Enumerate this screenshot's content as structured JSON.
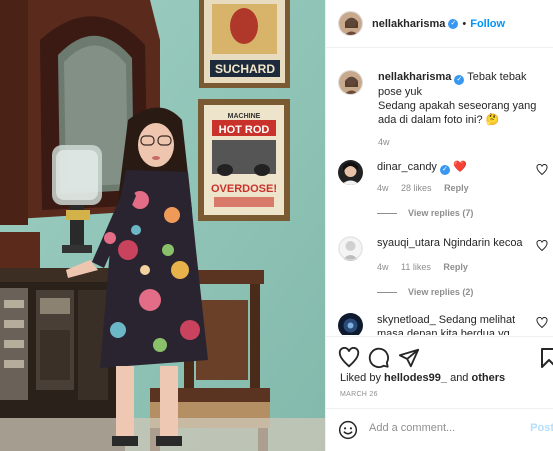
{
  "post": {
    "username": "nellakharisma",
    "follow_label": "Follow",
    "separator": "•",
    "caption_line1": "Tebak tebak pose yuk",
    "caption_line2": "Sedang apakah seseorang yang ada di dalam foto ini? 🤔",
    "caption_time": "4w",
    "liked_by_prefix": "Liked by ",
    "liked_by_user": "hellodes99_",
    "liked_by_and": " and ",
    "liked_by_others": "others",
    "date": "MARCH 26"
  },
  "photo": {
    "poster_top_text": "SUCHARD",
    "poster_bottom_title": "MACHINE",
    "poster_bottom_subtitle": "HOT ROD",
    "poster_bottom_main": "OVERDOSE!"
  },
  "comments": [
    {
      "username": "dinar_candy",
      "text": "❤️",
      "time": "4w",
      "likes": "28 likes",
      "reply": "Reply",
      "replies": "View replies (7)"
    },
    {
      "username": "syauqi_utara",
      "text": "Ngindarin kecoa",
      "time": "4w",
      "likes": "11 likes",
      "reply": "Reply",
      "replies": "View replies (2)"
    },
    {
      "username": "skynetload_",
      "text": "Sedang melihat masa depan kita berdua yg"
    }
  ],
  "add_comment": {
    "placeholder": "Add a comment...",
    "post_label": "Post"
  },
  "colors": {
    "accent": "#0095f6",
    "verified": "#3897f0",
    "wall": "#8fc4b6",
    "heart": "#ed4956"
  },
  "icons": [
    "verified-icon",
    "heart-icon",
    "comment-icon",
    "share-icon",
    "bookmark-icon",
    "emoji-icon"
  ]
}
